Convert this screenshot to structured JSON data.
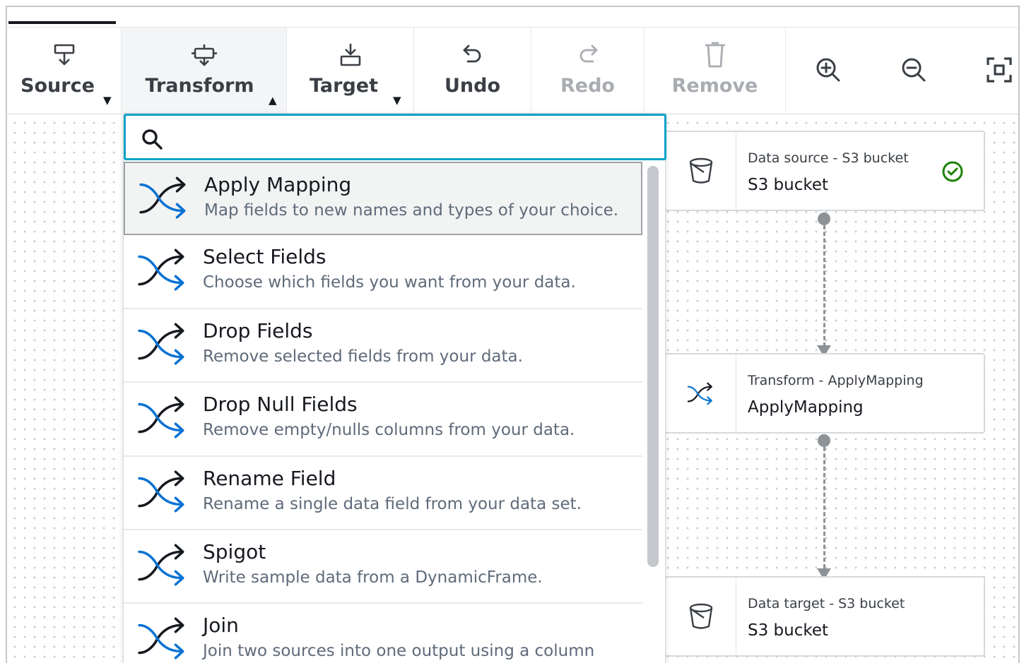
{
  "toolbar": {
    "source_label": "Source",
    "transform_label": "Transform",
    "target_label": "Target",
    "undo_label": "Undo",
    "redo_label": "Redo",
    "remove_label": "Remove",
    "zoom_in_icon": "zoom-in-icon",
    "zoom_out_icon": "zoom-out-icon",
    "fit_icon": "fit-to-screen-icon"
  },
  "search": {
    "value": "",
    "placeholder": ""
  },
  "transforms": [
    {
      "name": "Apply Mapping",
      "desc": "Map fields to new names and types of your choice."
    },
    {
      "name": "Select Fields",
      "desc": "Choose which fields you want from your data."
    },
    {
      "name": "Drop Fields",
      "desc": "Remove selected fields from your data."
    },
    {
      "name": "Drop Null Fields",
      "desc": "Remove empty/nulls columns from your data."
    },
    {
      "name": "Rename Field",
      "desc": "Rename a single data field from your data set."
    },
    {
      "name": "Spigot",
      "desc": "Write sample data from a DynamicFrame."
    },
    {
      "name": "Join",
      "desc": "Join two sources into one output using a column"
    }
  ],
  "nodes": {
    "source": {
      "title": "Data source - S3 bucket",
      "name": "S3 bucket",
      "icon": "bucket-icon",
      "status": "success"
    },
    "transform": {
      "title": "Transform - ApplyMapping",
      "name": "ApplyMapping",
      "icon": "shuffle-icon"
    },
    "target": {
      "title": "Data target - S3 bucket",
      "name": "S3 bucket",
      "icon": "bucket-icon"
    }
  },
  "colors": {
    "accent": "#0aa2c8",
    "success": "#1d8102",
    "icon_blue": "#0972d3"
  }
}
